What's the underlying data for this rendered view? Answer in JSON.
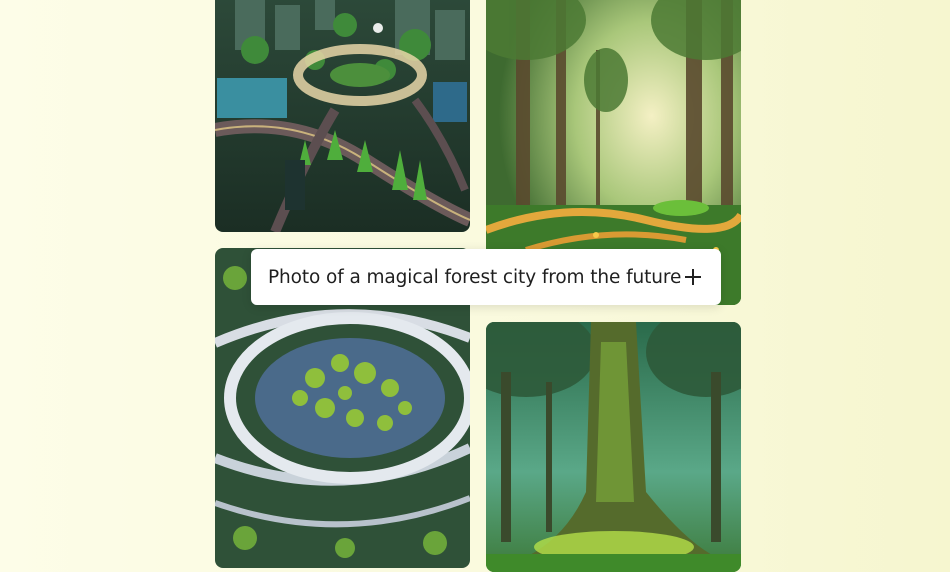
{
  "prompt": {
    "text": "Photo of a magical forest city from the future",
    "add_icon": "plus-icon"
  },
  "images": [
    {
      "name": "futuristic-forest-city-roundabout",
      "position": "top-left"
    },
    {
      "name": "sunlit-magical-forest-path",
      "position": "top-right"
    },
    {
      "name": "aerial-eye-shaped-forest-city",
      "position": "bottom-left"
    },
    {
      "name": "ancient-glowing-forest-tree",
      "position": "bottom-right"
    }
  ],
  "colors": {
    "background": "#fbfbe2",
    "chip_background": "#ffffff",
    "text": "#1f1f1f"
  }
}
